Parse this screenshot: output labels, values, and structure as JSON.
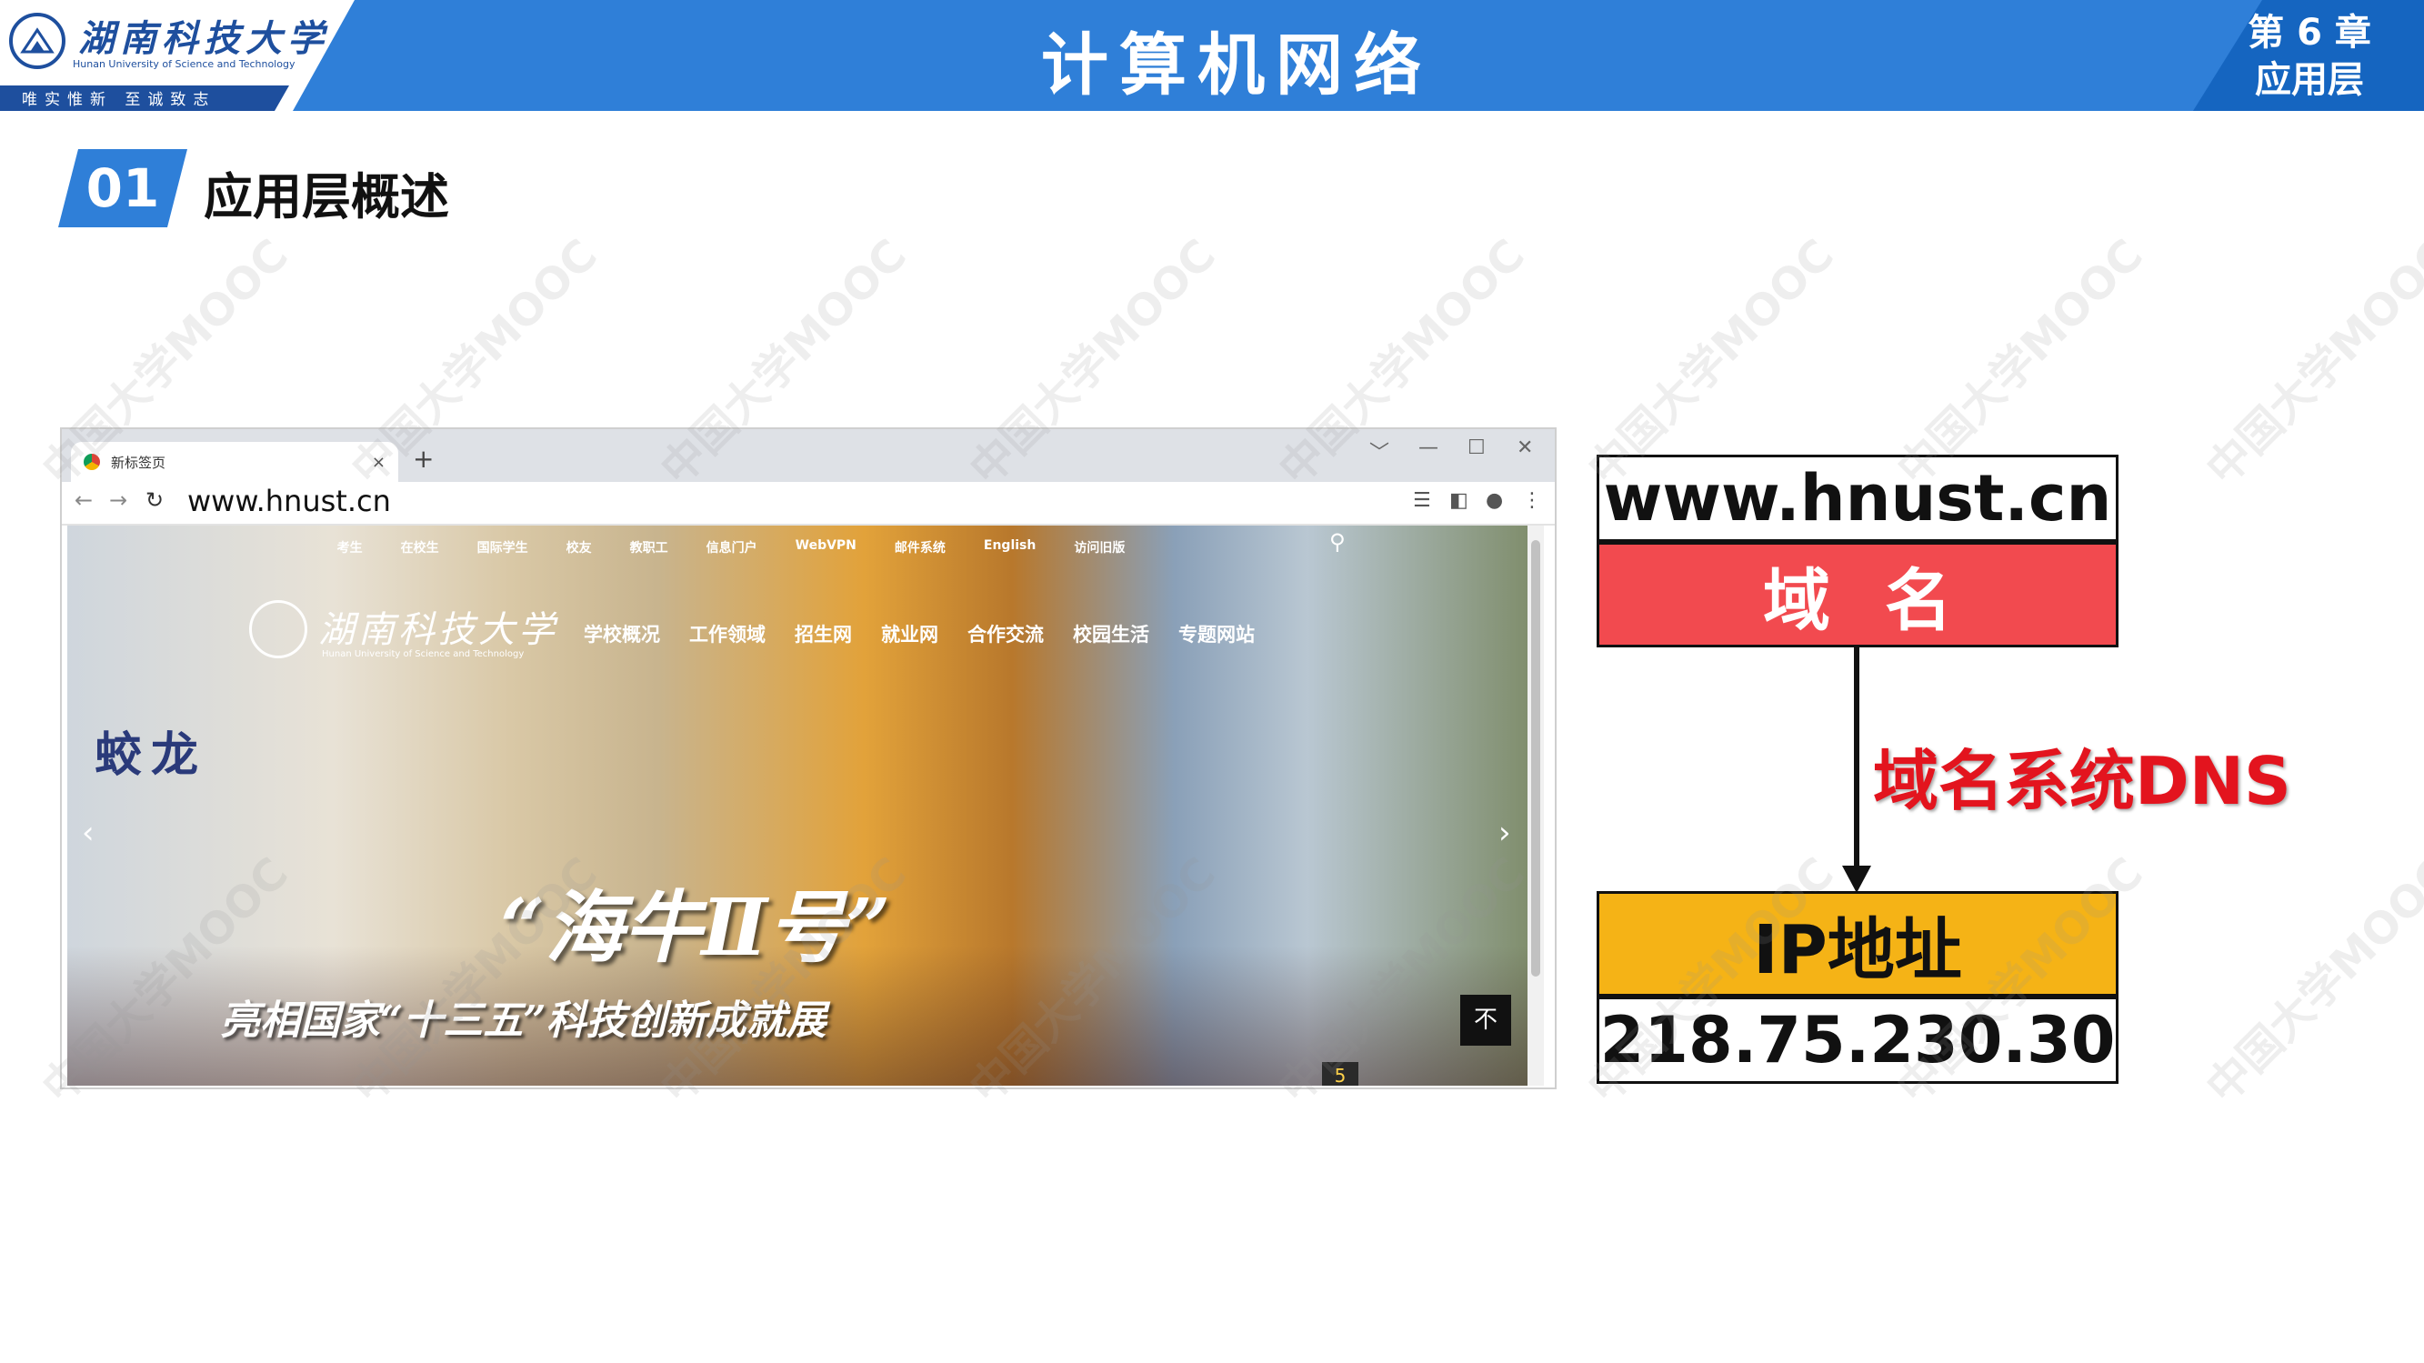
{
  "header": {
    "logo_name_cn": "湖南科技大学",
    "logo_name_en": "Hunan University of Science and Technology",
    "logo_motto": "唯实惟新  至诚致志",
    "course_title": "计算机网络",
    "chapter_num": "第 6 章",
    "chapter_name": "应用层"
  },
  "section": {
    "number": "01",
    "title": "应用层概述"
  },
  "browser": {
    "tab_title": "新标签页",
    "tab_close": "×",
    "new_tab": "+",
    "address": "www.hnust.cn",
    "window_controls": [
      "﹀",
      "—",
      "☐",
      "✕"
    ],
    "nav_icons": [
      "←",
      "→",
      "↻"
    ],
    "toolbar_icons": [
      "☰",
      "◧",
      "●",
      "⋮"
    ]
  },
  "website": {
    "top_nav": [
      "考生",
      "在校生",
      "国际学生",
      "校友",
      "教职工",
      "信息门户",
      "WebVPN",
      "邮件系统",
      "English",
      "访问旧版"
    ],
    "logo_cn": "湖南科技大学",
    "logo_en": "Hunan University of Science and Technology",
    "main_nav": [
      "学校概况",
      "工作领域",
      "招生网",
      "就业网",
      "合作交流",
      "校园生活",
      "专题网站"
    ],
    "sub_name": "蛟龙",
    "hero_headline": "“海牛Ⅱ号”",
    "hero_subline": "亮相国家“十三五”科技创新成就展",
    "slide_index": "5",
    "to_top": "不",
    "arrow_left": "‹",
    "arrow_right": "›",
    "search_icon": "⚲"
  },
  "diagram": {
    "domain_value": "www.hnust.cn",
    "domain_label": "域名",
    "dns_label": "域名系统DNS",
    "ip_label": "IP地址",
    "ip_value": "218.75.230.30"
  },
  "watermark_text": "中国大学MOOC",
  "colors": {
    "header_blue": "#2f7fd8",
    "header_dark_blue": "#1565c0",
    "domain_red": "#f24a4f",
    "ip_yellow": "#f5b316",
    "dns_red": "#e3141e"
  }
}
